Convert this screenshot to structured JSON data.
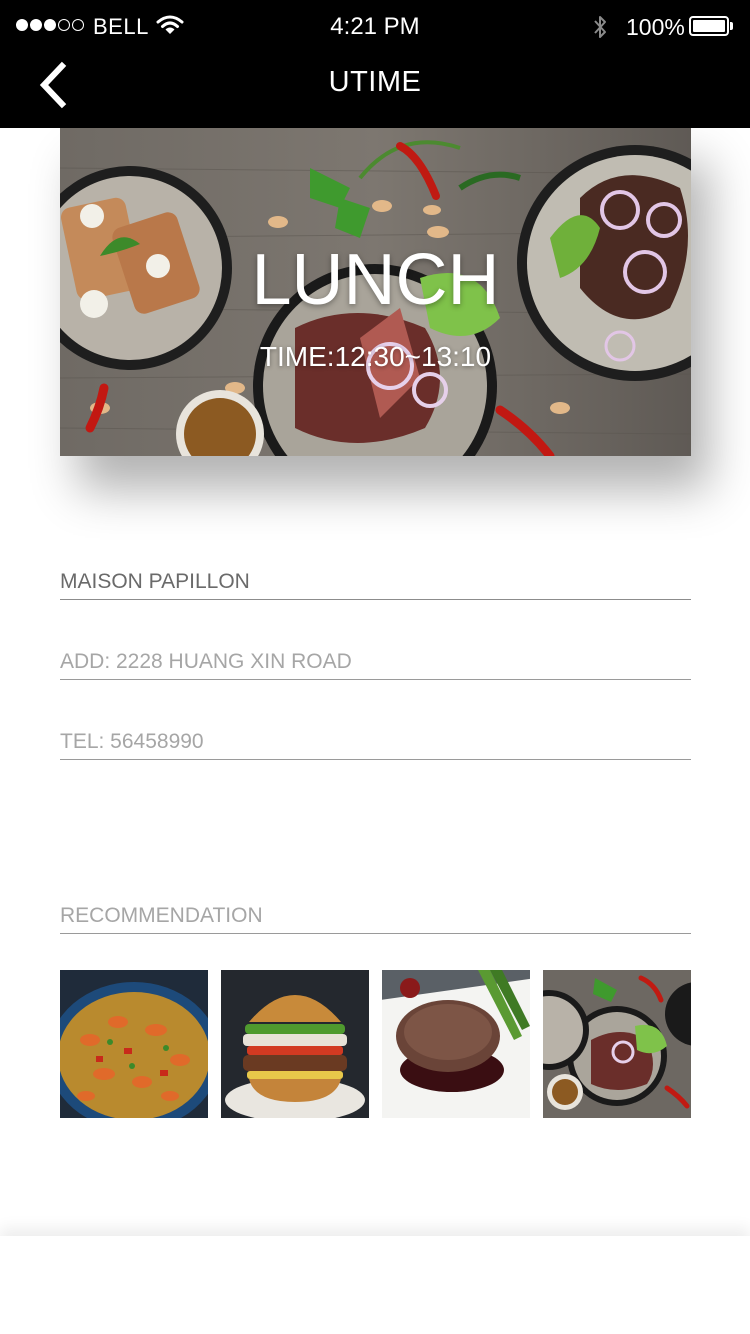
{
  "status_bar": {
    "carrier": "BELL",
    "time": "4:21 PM",
    "battery": "100%",
    "signal_strength": 3,
    "signal_max": 5
  },
  "nav": {
    "title": "UTIME",
    "back_icon": "chevron-left-icon"
  },
  "hero": {
    "title": "LUNCH",
    "time": "TIME:12:30~13:10"
  },
  "restaurant": {
    "name": "MAISON PAPILLON",
    "address": "ADD:  2228 HUANG XIN ROAD",
    "tel": "TEL:  56458990"
  },
  "recommendation": {
    "label": "RECOMMENDATION"
  },
  "colors": {
    "bar": "#000000",
    "background": "#ffffff",
    "name_text": "#6a6a6a",
    "muted_text": "#a6a6a6"
  }
}
